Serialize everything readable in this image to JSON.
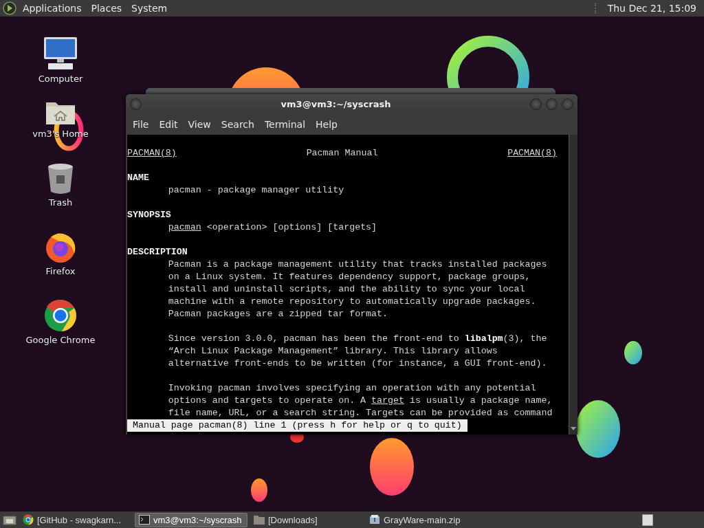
{
  "top_panel": {
    "menus": [
      "Applications",
      "Places",
      "System"
    ],
    "clock": "Thu Dec 21, 15:09"
  },
  "desktop_icons": [
    {
      "label": "Computer",
      "kind": "computer"
    },
    {
      "label": "vm3's Home",
      "kind": "home"
    },
    {
      "label": "Trash",
      "kind": "trash"
    },
    {
      "label": "Firefox",
      "kind": "firefox"
    },
    {
      "label": "Google Chrome",
      "kind": "chrome"
    }
  ],
  "terminal": {
    "title": "vm3@vm3:~/syscrash",
    "menu": [
      "File",
      "Edit",
      "View",
      "Search",
      "Terminal",
      "Help"
    ],
    "man_header": {
      "left": "PACMAN(8)",
      "center": "Pacman Manual",
      "right": "PACMAN(8)"
    },
    "lines": [
      {
        "kind": "blank"
      },
      {
        "kind": "heading",
        "text": "NAME"
      },
      {
        "kind": "body",
        "text": "pacman - package manager utility"
      },
      {
        "kind": "blank"
      },
      {
        "kind": "heading",
        "text": "SYNOPSIS"
      },
      {
        "kind": "body",
        "segments": [
          {
            "text": "pacman",
            "kind": "argument"
          },
          {
            "text": " <operation> [options] [targets]",
            "kind": "plain"
          }
        ]
      },
      {
        "kind": "blank"
      },
      {
        "kind": "heading",
        "text": "DESCRIPTION"
      },
      {
        "kind": "body",
        "text": "Pacman is a package management utility that tracks installed packages"
      },
      {
        "kind": "body",
        "text": "on a Linux system. It features dependency support, package groups,"
      },
      {
        "kind": "body",
        "text": "install and uninstall scripts, and the ability to sync your local"
      },
      {
        "kind": "body",
        "text": "machine with a remote repository to automatically upgrade packages."
      },
      {
        "kind": "body",
        "text": "Pacman packages are a zipped tar format."
      },
      {
        "kind": "blank"
      },
      {
        "kind": "body",
        "text": "Since version 3.0.0, pacman has been the front-end to **libalpm**(3), the"
      },
      {
        "kind": "body",
        "text": "“Arch Linux Package Management” library. This library allows"
      },
      {
        "kind": "body",
        "text": "alternative front-ends to be written (for instance, a GUI front-end)."
      },
      {
        "kind": "blank"
      },
      {
        "kind": "body",
        "text": "Invoking pacman involves specifying an operation with any potential"
      },
      {
        "kind": "body",
        "segments": [
          {
            "text": "options and targets to operate on. A ",
            "kind": "plain"
          },
          {
            "text": "target",
            "kind": "argument"
          },
          {
            "text": " is usually a package name,",
            "kind": "plain"
          }
        ]
      },
      {
        "kind": "body",
        "text": "file name, URL, or a search string. Targets can be provided as command"
      }
    ],
    "status": "Manual page pacman(8) line 1 (press h for help or q to quit)"
  },
  "taskbar": {
    "tasks": [
      {
        "label": "[GitHub - swagkarn...",
        "kind": "browser",
        "selected": false
      },
      {
        "label": "vm3@vm3:~/syscrash",
        "kind": "terminal",
        "selected": true
      },
      {
        "label": "[Downloads]",
        "kind": "folder",
        "selected": false
      },
      {
        "label": "GrayWare-main.zip",
        "kind": "archive",
        "selected": false
      }
    ]
  }
}
